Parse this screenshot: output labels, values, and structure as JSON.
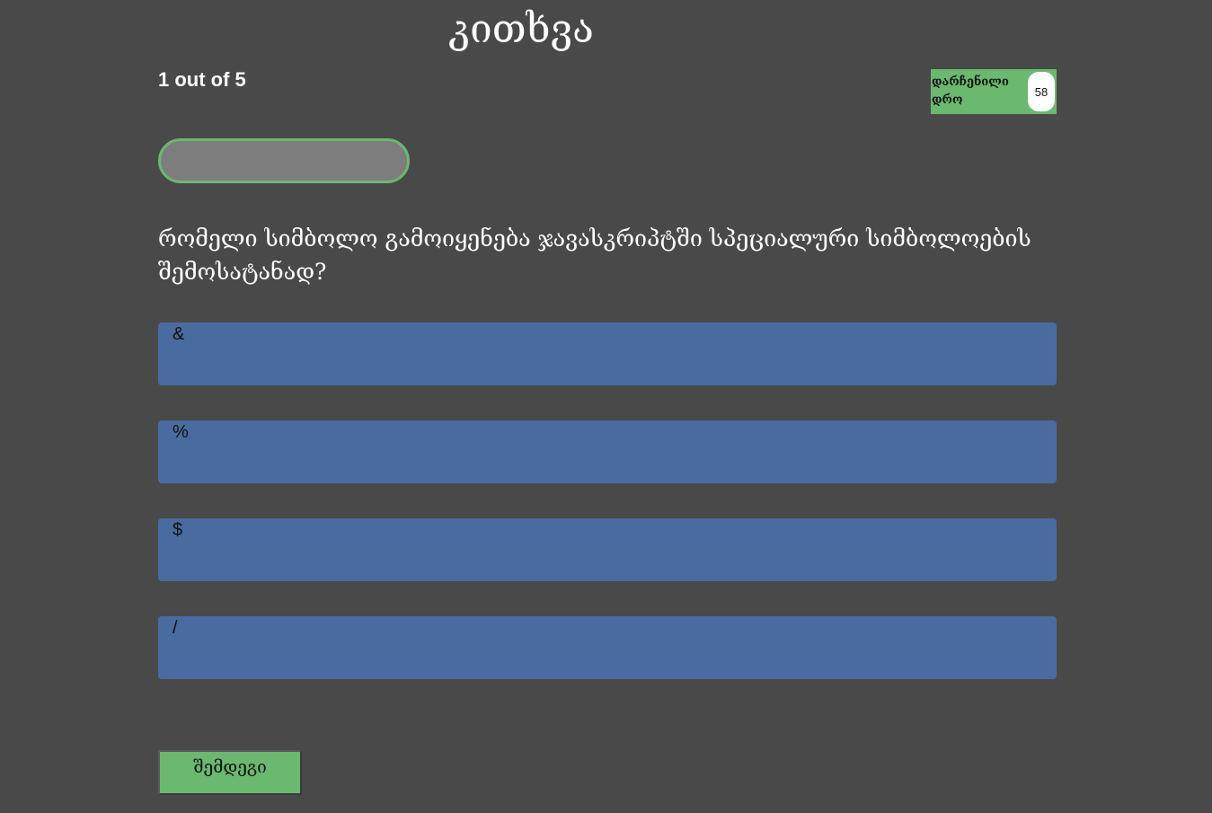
{
  "header": {
    "title": "კითხვა",
    "progress_text": "1 out of 5"
  },
  "timer": {
    "label": "დარჩენილი დრო",
    "value": "58"
  },
  "progress_bar": {
    "fraction": 0
  },
  "question": {
    "text": "რომელი სიმბოლო გამოიყენება ჯავასკრიპტში სპეციალური სიმბოლოების შემოსატანად?"
  },
  "answers": [
    {
      "label": "&"
    },
    {
      "label": "%"
    },
    {
      "label": "$"
    },
    {
      "label": "/"
    }
  ],
  "footer": {
    "next_label": "შემდეგი"
  },
  "colors": {
    "background": "#494949",
    "accent_green": "#6bb86f",
    "answer_blue": "#496ba0",
    "progress_track": "#7d7d7d"
  }
}
